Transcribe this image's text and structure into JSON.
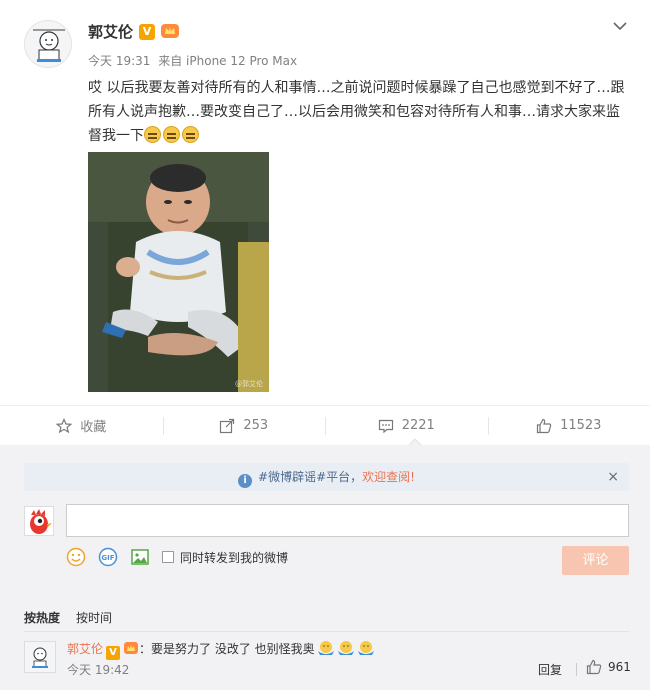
{
  "post": {
    "username": "郭艾伦",
    "verified_label": "V",
    "time": "今天 19:31",
    "source": "来自 iPhone 12 Pro Max",
    "text": "哎 以后我要友善对待所有的人和事情…之前说问题时候暴躁了自己也感觉到不好了…跟所有人说声抱歉…要改变自己了…以后会用微笑和包容对待所有人和事…请求大家来监督我一下",
    "emojis": [
      "expressionless-emoji",
      "expressionless-emoji",
      "expressionless-emoji"
    ],
    "photo_watermark": "@郭艾伦"
  },
  "actions": {
    "favorite_label": "收藏",
    "repost_count": "253",
    "comment_count": "2221",
    "like_count": "11523"
  },
  "comment_box": {
    "notice_prefix": "#微博辟谣#平台，",
    "notice_link": "欢迎查阅!",
    "notice_close": "×",
    "input_value": "",
    "repost_checkbox_label": "同时转发到我的微博",
    "submit_label": "评论"
  },
  "sort": {
    "by_hot": "按热度",
    "by_time": "按时间"
  },
  "comments": [
    {
      "name": "郭艾伦",
      "verified_label": "V",
      "text": "：要是努力了 没改了 也别怪我奥",
      "emojis": [
        "hug-emoji",
        "hug-emoji",
        "hug-emoji"
      ],
      "time": "今天 19:42",
      "reply_label": "回复",
      "like_count": "961"
    }
  ],
  "colors": {
    "accent": "#eb7350",
    "verified": "#f6a500",
    "notice_text": "#4b6a8e",
    "submit_disabled": "#f8c6b0"
  }
}
